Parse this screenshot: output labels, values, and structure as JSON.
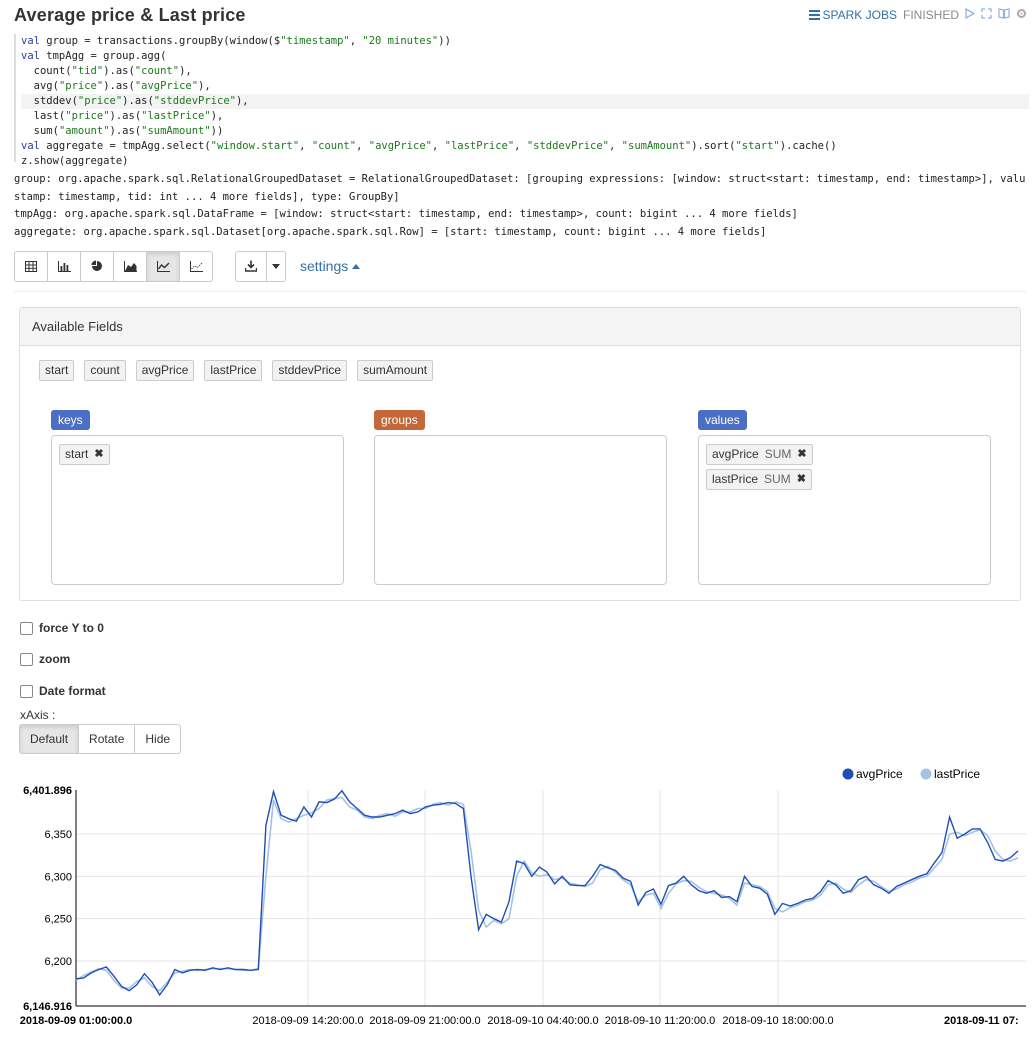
{
  "paragraph": {
    "title": "Average price & Last price",
    "spark_jobs_label": "SPARK JOBS",
    "status": "FINISHED"
  },
  "code_lines": [
    [
      {
        "t": "val",
        "c": "kw"
      },
      {
        "t": " group = transactions.groupBy(window($"
      },
      {
        "t": "\"timestamp\"",
        "c": "str"
      },
      {
        "t": ", "
      },
      {
        "t": "\"20 minutes\"",
        "c": "str"
      },
      {
        "t": "))"
      }
    ],
    [
      {
        "t": "val",
        "c": "kw"
      },
      {
        "t": " tmpAgg = group.agg("
      }
    ],
    [
      {
        "t": "  count("
      },
      {
        "t": "\"tid\"",
        "c": "str"
      },
      {
        "t": ").as("
      },
      {
        "t": "\"count\"",
        "c": "str"
      },
      {
        "t": "),"
      }
    ],
    [
      {
        "t": "  avg("
      },
      {
        "t": "\"price\"",
        "c": "str"
      },
      {
        "t": ").as("
      },
      {
        "t": "\"avgPrice\"",
        "c": "str"
      },
      {
        "t": "),"
      }
    ],
    [
      {
        "t": "  stddev("
      },
      {
        "t": "\"price\"",
        "c": "str"
      },
      {
        "t": ").as("
      },
      {
        "t": "\"stddevPrice\"",
        "c": "str"
      },
      {
        "t": "),"
      }
    ],
    [
      {
        "t": "  last("
      },
      {
        "t": "\"price\"",
        "c": "str"
      },
      {
        "t": ").as("
      },
      {
        "t": "\"lastPrice\"",
        "c": "str"
      },
      {
        "t": "),"
      }
    ],
    [
      {
        "t": "  sum("
      },
      {
        "t": "\"amount\"",
        "c": "str"
      },
      {
        "t": ").as("
      },
      {
        "t": "\"sumAmount\"",
        "c": "str"
      },
      {
        "t": "))"
      }
    ],
    [
      {
        "t": "val",
        "c": "kw"
      },
      {
        "t": " aggregate = tmpAgg.select("
      },
      {
        "t": "\"window.start\"",
        "c": "str"
      },
      {
        "t": ", "
      },
      {
        "t": "\"count\"",
        "c": "str"
      },
      {
        "t": ", "
      },
      {
        "t": "\"avgPrice\"",
        "c": "str"
      },
      {
        "t": ", "
      },
      {
        "t": "\"lastPrice\"",
        "c": "str"
      },
      {
        "t": ", "
      },
      {
        "t": "\"stddevPrice\"",
        "c": "str"
      },
      {
        "t": ", "
      },
      {
        "t": "\"sumAmount\"",
        "c": "str"
      },
      {
        "t": ").sort("
      },
      {
        "t": "\"start\"",
        "c": "str"
      },
      {
        "t": ").cache()"
      }
    ],
    [
      {
        "t": "z.show(aggregate)"
      }
    ]
  ],
  "output_lines": [
    "group: org.apache.spark.sql.RelationalGroupedDataset = RelationalGroupedDataset: [grouping expressions: [window: struct<start: timestamp, end: timestamp>], value: [time",
    "stamp: timestamp, tid: int ... 4 more fields], type: GroupBy]",
    "tmpAgg: org.apache.spark.sql.DataFrame = [window: struct<start: timestamp, end: timestamp>, count: bigint ... 4 more fields]",
    "aggregate: org.apache.spark.sql.Dataset[org.apache.spark.sql.Row] = [start: timestamp, count: bigint ... 4 more fields]"
  ],
  "toolbar": {
    "settings_label": "settings"
  },
  "fields": {
    "heading": "Available Fields",
    "available": [
      "start",
      "count",
      "avgPrice",
      "lastPrice",
      "stddevPrice",
      "sumAmount"
    ],
    "keys_label": "keys",
    "groups_label": "groups",
    "values_label": "values",
    "keys": [
      "start"
    ],
    "values": [
      {
        "name": "avgPrice",
        "agg": "SUM"
      },
      {
        "name": "lastPrice",
        "agg": "SUM"
      }
    ]
  },
  "options": {
    "force_y0": "force Y to 0",
    "zoom": "zoom",
    "date_format": "Date format",
    "xaxis_label": "xAxis :",
    "xaxis_default": "Default",
    "xaxis_rotate": "Rotate",
    "xaxis_hide": "Hide"
  },
  "colors": {
    "keys": "#4a6fc4",
    "groups": "#c4683a",
    "values": "#4a6fc4",
    "link": "#3071a9",
    "avg_series": "#1f4fb4",
    "last_series": "#a4c2e6"
  },
  "chart_data": {
    "type": "line",
    "y_tick_labels": [
      "6,146.916",
      "6,200",
      "6,250",
      "6,300",
      "6,350",
      "6,401.896"
    ],
    "ylim": [
      6146.916,
      6401.896
    ],
    "x_tick_labels": [
      "2018-09-09 01:00:00.0",
      "2018-09-09 14:20:00.0",
      "2018-09-09 21:00:00.0",
      "2018-09-10 04:40:00.0",
      "2018-09-10 11:20:00.0",
      "2018-09-10 18:00:00.0",
      "2018-09-11 07:"
    ],
    "x_range": [
      "2018-09-09 01:00",
      "2018-09-11 07:20"
    ],
    "legend_position": "top-right",
    "series": [
      {
        "name": "avgPrice",
        "values": [
          6179,
          6180,
          6186,
          6190,
          6193,
          6182,
          6170,
          6165,
          6172,
          6185,
          6175,
          6160,
          6172,
          6190,
          6186,
          6189,
          6190,
          6189,
          6192,
          6190,
          6192,
          6190,
          6190,
          6189,
          6190,
          6360,
          6400,
          6372,
          6368,
          6365,
          6382,
          6370,
          6388,
          6387,
          6391,
          6401,
          6388,
          6380,
          6372,
          6370,
          6370,
          6372,
          6374,
          6378,
          6374,
          6376,
          6382,
          6384,
          6385,
          6387,
          6386,
          6380,
          6300,
          6237,
          6255,
          6250,
          6246,
          6270,
          6318,
          6315,
          6300,
          6311,
          6305,
          6291,
          6300,
          6290,
          6289,
          6289,
          6300,
          6314,
          6310,
          6307,
          6298,
          6294,
          6266,
          6281,
          6285,
          6267,
          6289,
          6292,
          6300,
          6290,
          6283,
          6280,
          6283,
          6275,
          6276,
          6270,
          6300,
          6288,
          6286,
          6279,
          6255,
          6268,
          6265,
          6268,
          6272,
          6274,
          6282,
          6295,
          6290,
          6280,
          6283,
          6296,
          6300,
          6290,
          6286,
          6280,
          6288,
          6292,
          6296,
          6300,
          6303,
          6316,
          6328,
          6370,
          6345,
          6350,
          6356,
          6356,
          6340,
          6320,
          6318,
          6322,
          6330
        ]
      },
      {
        "name": "lastPrice",
        "values": [
          6177,
          6183,
          6187,
          6191,
          6189,
          6177,
          6168,
          6168,
          6176,
          6180,
          6170,
          6165,
          6175,
          6186,
          6188,
          6190,
          6189,
          6190,
          6191,
          6191,
          6191,
          6190,
          6189,
          6189,
          6191,
          6300,
          6390,
          6368,
          6364,
          6368,
          6372,
          6375,
          6380,
          6390,
          6392,
          6393,
          6382,
          6378,
          6370,
          6368,
          6372,
          6374,
          6371,
          6376,
          6376,
          6380,
          6380,
          6385,
          6387,
          6384,
          6388,
          6385,
          6330,
          6260,
          6240,
          6248,
          6244,
          6250,
          6300,
          6318,
          6304,
          6300,
          6302,
          6296,
          6298,
          6292,
          6290,
          6288,
          6292,
          6308,
          6312,
          6305,
          6296,
          6290,
          6270,
          6278,
          6280,
          6262,
          6280,
          6291,
          6295,
          6294,
          6287,
          6282,
          6280,
          6278,
          6274,
          6266,
          6292,
          6290,
          6288,
          6282,
          6262,
          6258,
          6263,
          6266,
          6270,
          6272,
          6278,
          6290,
          6292,
          6285,
          6281,
          6290,
          6296,
          6294,
          6288,
          6282,
          6285,
          6290,
          6293,
          6298,
          6300,
          6310,
          6320,
          6350,
          6352,
          6348,
          6352,
          6355,
          6348,
          6330,
          6320,
          6318,
          6322
        ]
      }
    ]
  }
}
